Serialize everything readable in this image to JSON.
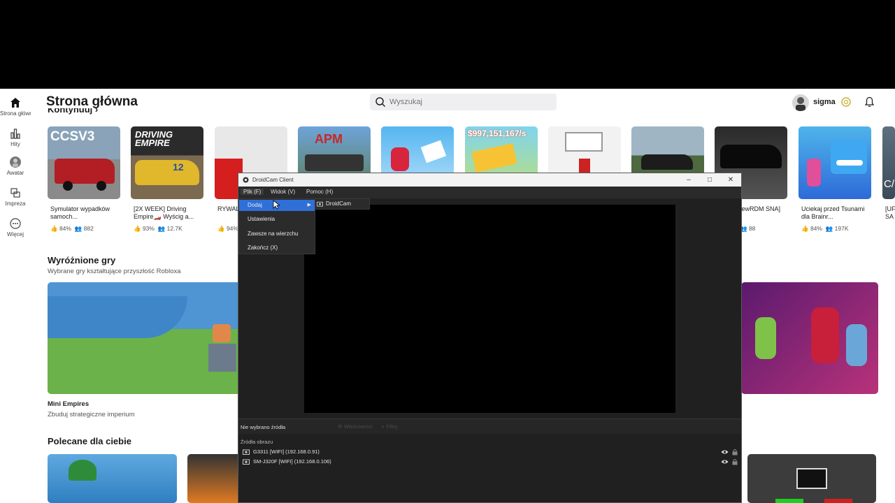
{
  "nav": {
    "items": [
      {
        "label": "Strona główna",
        "icon": "home-icon"
      },
      {
        "label": "Hity",
        "icon": "charts-icon"
      },
      {
        "label": "Awatar",
        "icon": "avatar-icon"
      },
      {
        "label": "Impreza",
        "icon": "party-icon"
      },
      {
        "label": "Więcej",
        "icon": "more-icon"
      }
    ]
  },
  "header": {
    "title": "Strona główna",
    "search_placeholder": "Wyszukaj",
    "username": "sigma"
  },
  "sections": {
    "continue_label": "Kontynuuj ›",
    "featured_title": "Wyróżnione gry",
    "featured_sub": "Wybrane gry kształtujące przyszłość Robloxa",
    "featured_game_name": "Mini Empires",
    "featured_game_desc": "Zbuduj strategiczne imperium",
    "recommended_title": "Polecane dla ciebie"
  },
  "tiles": [
    {
      "name": "Symulator wypadków samoch...",
      "rating": "84%",
      "players": "882",
      "thumb_text": "CCSV3"
    },
    {
      "name": "[2X WEEK] Driving Empire🏎️ Wyścig a...",
      "rating": "93%",
      "players": "12.7K",
      "thumb_text": "DRIVING EMPIRE"
    },
    {
      "name": "RYWAL",
      "rating": "94%",
      "players": "",
      "thumb_text": ""
    },
    {
      "name": "",
      "rating": "",
      "players": "",
      "thumb_text": "APM"
    },
    {
      "name": "",
      "rating": "",
      "players": "",
      "thumb_text": ""
    },
    {
      "name": "",
      "rating": "",
      "players": "",
      "thumb_text": "$997,151,167/s"
    },
    {
      "name": "",
      "rating": "",
      "players": "",
      "thumb_text": ""
    },
    {
      "name": "",
      "rating": "",
      "players": "",
      "thumb_text": ""
    },
    {
      "name": "zewRDM SNA]",
      "rating": "",
      "players": "88",
      "thumb_text": ""
    },
    {
      "name": "Uciekaj przed Tsunami dla Brainr...",
      "rating": "84%",
      "players": "197K",
      "thumb_text": ""
    },
    {
      "name": "[UF SA",
      "rating": "",
      "players": "",
      "thumb_text": "C/"
    }
  ],
  "droidcam": {
    "title": "DroidCam Client",
    "menu": [
      "Plik (F)",
      "Widok (V)",
      "Pomoc (H)"
    ],
    "file_menu": [
      "Dodaj",
      "Ustawienia",
      "Zawsze na wierzchu",
      "Zakończ (X)"
    ],
    "submenu": [
      "DroidCam"
    ],
    "status_no_source": "Nie wybrano źródła",
    "status_properties": "Właściwości",
    "status_filters": "Filtry",
    "sources_header": "Źródła obrazu",
    "sources": [
      "G3311 [WIFI] (192.168.0.91)",
      "SM-J320F [WIFI] (192.168.0.106)"
    ]
  },
  "colors": {
    "menu_highlight": "#2f6fd8",
    "dark_bg": "#202020"
  }
}
